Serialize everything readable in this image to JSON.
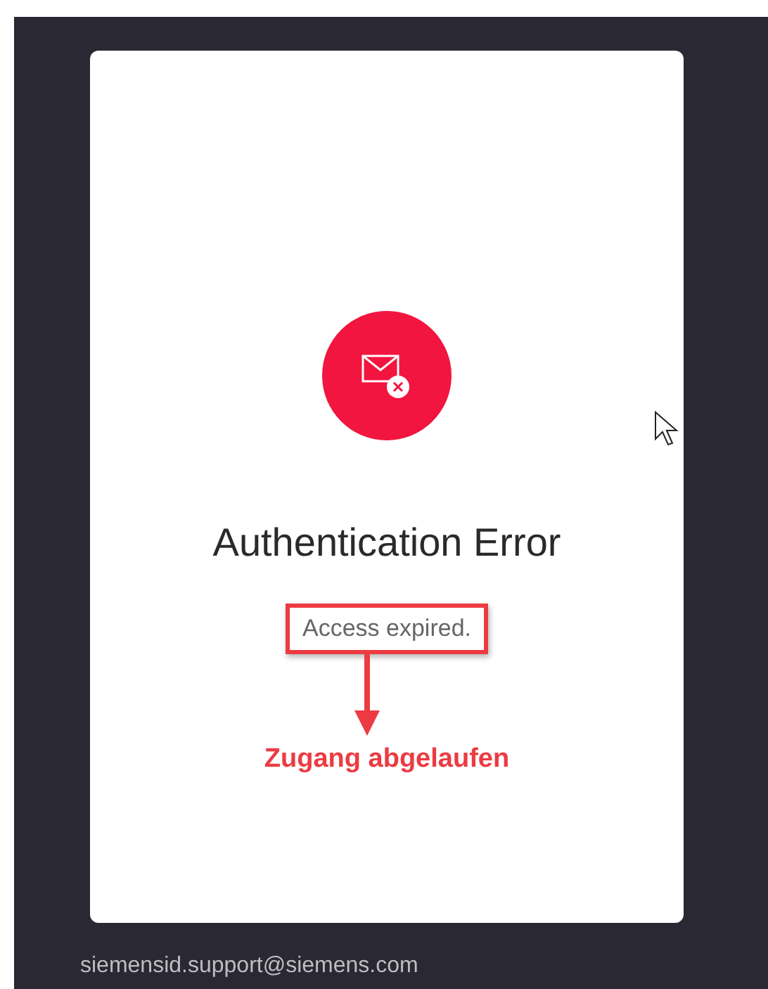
{
  "card": {
    "title": "Authentication Error",
    "message": "Access expired."
  },
  "annotation": {
    "text": "Zugang abgelaufen"
  },
  "footer": {
    "email": "siemensid.support@siemens.com"
  }
}
